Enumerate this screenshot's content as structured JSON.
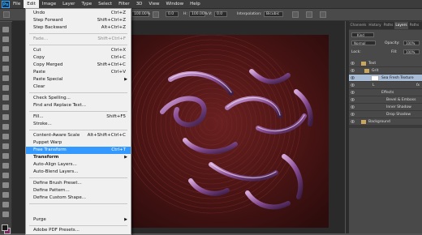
{
  "menubar": {
    "logo": "Ps",
    "items": [
      "File",
      "Edit",
      "Image",
      "Layer",
      "Type",
      "Select",
      "Filter",
      "3D",
      "View",
      "Window",
      "Help"
    ],
    "active_index": 1
  },
  "options_bar": {
    "zoom": "100.00%",
    "angle": "0.0",
    "h_label": "H:",
    "h_value": "100.00%",
    "v_label": "V:",
    "v_value": "0.0",
    "interpolation_label": "Interpolation:",
    "interpolation_value": "Bicubic"
  },
  "edit_menu": {
    "items": [
      {
        "label": "Undo",
        "shortcut": "Ctrl+Z"
      },
      {
        "label": "Step Forward",
        "shortcut": "Shift+Ctrl+Z"
      },
      {
        "label": "Step Backward",
        "shortcut": "Alt+Ctrl+Z"
      },
      {
        "label": "Fade...",
        "shortcut": "Shift+Ctrl+F"
      },
      {
        "label": "Cut",
        "shortcut": "Ctrl+X"
      },
      {
        "label": "Copy",
        "shortcut": "Ctrl+C"
      },
      {
        "label": "Copy Merged",
        "shortcut": "Shift+Ctrl+C"
      },
      {
        "label": "Paste",
        "shortcut": "Ctrl+V"
      },
      {
        "label": "Paste Special",
        "shortcut": ""
      },
      {
        "label": "Clear",
        "shortcut": ""
      },
      {
        "label": "Check Spelling...",
        "shortcut": ""
      },
      {
        "label": "Find and Replace Text...",
        "shortcut": ""
      },
      {
        "label": "Fill...",
        "shortcut": "Shift+F5"
      },
      {
        "label": "Stroke...",
        "shortcut": ""
      },
      {
        "label": "Content-Aware Scale",
        "shortcut": "Alt+Shift+Ctrl+C"
      },
      {
        "label": "Puppet Warp",
        "shortcut": ""
      },
      {
        "label": "Free Transform",
        "shortcut": "Ctrl+T"
      },
      {
        "label": "Transform",
        "shortcut": ""
      },
      {
        "label": "Auto-Align Layers...",
        "shortcut": ""
      },
      {
        "label": "Auto-Blend Layers...",
        "shortcut": ""
      },
      {
        "label": "Define Brush Preset...",
        "shortcut": ""
      },
      {
        "label": "Define Pattern...",
        "shortcut": ""
      },
      {
        "label": "Define Custom Shape...",
        "shortcut": ""
      },
      {
        "label": "Purge",
        "shortcut": ""
      },
      {
        "label": "Adobe PDF Presets...",
        "shortcut": ""
      }
    ]
  },
  "panels": {
    "tabs": [
      "Channels",
      "History",
      "Paths",
      "Layers",
      "Paths"
    ],
    "active_tab": "Layers",
    "kind_label": "Kind",
    "blend_mode": "Normal",
    "opacity_label": "Opacity:",
    "opacity_value": "100%",
    "lock_label": "Lock:",
    "fill_label": "Fill:",
    "fill_value": "100%",
    "layers": [
      {
        "name": "Text"
      },
      {
        "name": "Grit"
      },
      {
        "name": "Sea Fresh Texture"
      },
      {
        "name": "L"
      },
      {
        "name": "Effects"
      },
      {
        "name": "Bevel & Emboss"
      },
      {
        "name": "Inner Shadow"
      },
      {
        "name": "Drop Shadow"
      },
      {
        "name": "Background"
      }
    ]
  },
  "colors": {
    "canvas_bg": "#5b1a1a",
    "menu_highlight": "#3399ff",
    "foreground_swatch": "#1a1a1a",
    "background_swatch": "#7a2860"
  }
}
